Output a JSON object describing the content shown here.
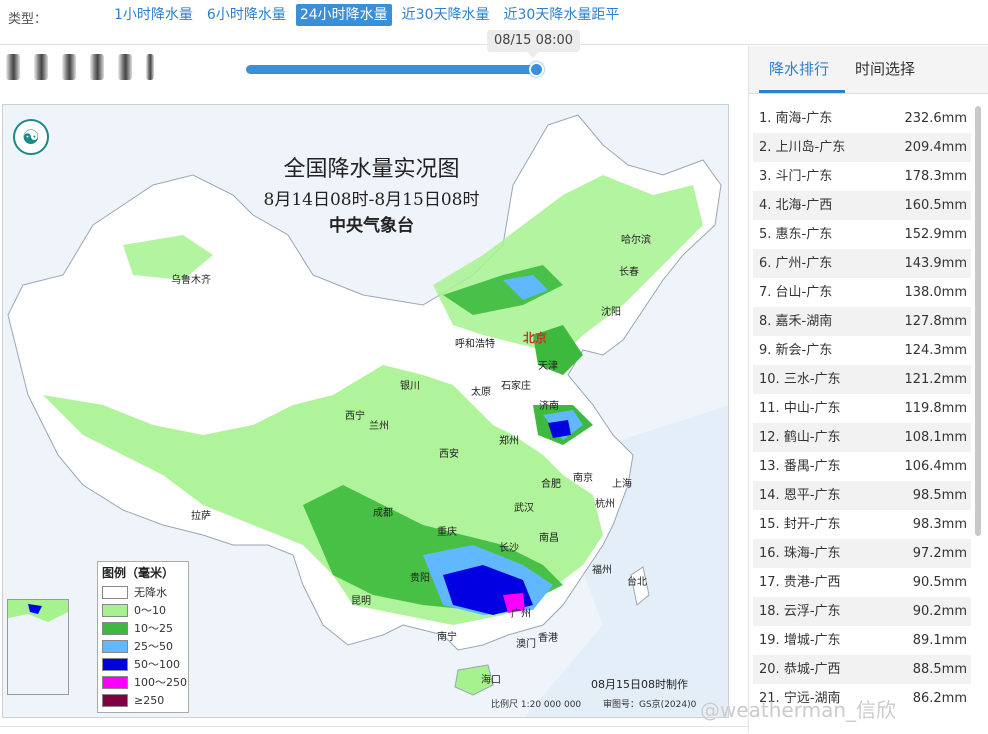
{
  "type_bar": {
    "label": "类型：",
    "tabs": [
      {
        "label": "1小时降水量",
        "active": false
      },
      {
        "label": "6小时降水量",
        "active": false
      },
      {
        "label": "24小时降水量",
        "active": true
      },
      {
        "label": "近30天降水量",
        "active": false
      },
      {
        "label": "近30天降水量距平",
        "active": false
      }
    ]
  },
  "timeline": {
    "current_time": "08/15 08:00",
    "progress_fraction": 1.0,
    "accent": "#3a8fd6"
  },
  "map": {
    "title": "全国降水量实况图",
    "period": "8月14日08时-8月15日08时",
    "agency": "中央气象台",
    "made_time": "08月15日08时制作",
    "scale": "比例尺 1:20 000 000",
    "review": "审图号：GS京(2024)0",
    "cities": [
      {
        "name": "北京",
        "capital": true
      },
      {
        "name": "哈尔滨"
      },
      {
        "name": "长春"
      },
      {
        "name": "沈阳"
      },
      {
        "name": "乌鲁木齐"
      },
      {
        "name": "呼和浩特"
      },
      {
        "name": "天津"
      },
      {
        "name": "石家庄"
      },
      {
        "name": "太原"
      },
      {
        "name": "银川"
      },
      {
        "name": "济南"
      },
      {
        "name": "西宁"
      },
      {
        "name": "兰州"
      },
      {
        "name": "郑州"
      },
      {
        "name": "西安"
      },
      {
        "name": "合肥"
      },
      {
        "name": "南京"
      },
      {
        "name": "上海"
      },
      {
        "name": "拉萨"
      },
      {
        "name": "成都"
      },
      {
        "name": "武汉"
      },
      {
        "name": "杭州"
      },
      {
        "name": "重庆"
      },
      {
        "name": "长沙"
      },
      {
        "name": "南昌"
      },
      {
        "name": "福州"
      },
      {
        "name": "贵阳"
      },
      {
        "name": "台北"
      },
      {
        "name": "昆明"
      },
      {
        "name": "广州"
      },
      {
        "name": "南宁"
      },
      {
        "name": "香港"
      },
      {
        "name": "澳门"
      },
      {
        "name": "海口"
      }
    ],
    "legend": {
      "title": "图例（毫米）",
      "items": [
        {
          "label": "无降水",
          "color": "#ffffff"
        },
        {
          "label": "0～10",
          "color": "#a6f28f"
        },
        {
          "label": "10～25",
          "color": "#3dba3d"
        },
        {
          "label": "25～50",
          "color": "#61b8ff"
        },
        {
          "label": "50～100",
          "color": "#0000e1"
        },
        {
          "label": "100～250",
          "color": "#fa00fa"
        },
        {
          "label": "≥250",
          "color": "#800040"
        }
      ]
    }
  },
  "right_panel": {
    "tabs": [
      {
        "label": "降水排行",
        "active": true
      },
      {
        "label": "时间选择",
        "active": false
      }
    ],
    "rankings": [
      {
        "rank": "1.",
        "station": "南海-广东",
        "value": "232.6mm"
      },
      {
        "rank": "2.",
        "station": "上川岛-广东",
        "value": "209.4mm"
      },
      {
        "rank": "3.",
        "station": "斗门-广东",
        "value": "178.3mm"
      },
      {
        "rank": "4.",
        "station": "北海-广西",
        "value": "160.5mm"
      },
      {
        "rank": "5.",
        "station": "惠东-广东",
        "value": "152.9mm"
      },
      {
        "rank": "6.",
        "station": "广州-广东",
        "value": "143.9mm"
      },
      {
        "rank": "7.",
        "station": "台山-广东",
        "value": "138.0mm"
      },
      {
        "rank": "8.",
        "station": "嘉禾-湖南",
        "value": "127.8mm"
      },
      {
        "rank": "9.",
        "station": "新会-广东",
        "value": "124.3mm"
      },
      {
        "rank": "10.",
        "station": "三水-广东",
        "value": "121.2mm"
      },
      {
        "rank": "11.",
        "station": "中山-广东",
        "value": "119.8mm"
      },
      {
        "rank": "12.",
        "station": "鹤山-广东",
        "value": "108.1mm"
      },
      {
        "rank": "13.",
        "station": "番禺-广东",
        "value": "106.4mm"
      },
      {
        "rank": "14.",
        "station": "恩平-广东",
        "value": "98.5mm"
      },
      {
        "rank": "15.",
        "station": "封开-广东",
        "value": "98.3mm"
      },
      {
        "rank": "16.",
        "station": "珠海-广东",
        "value": "97.2mm"
      },
      {
        "rank": "17.",
        "station": "贵港-广西",
        "value": "90.5mm"
      },
      {
        "rank": "18.",
        "station": "云浮-广东",
        "value": "90.2mm"
      },
      {
        "rank": "19.",
        "station": "增城-广东",
        "value": "89.1mm"
      },
      {
        "rank": "20.",
        "station": "恭城-广西",
        "value": "88.5mm"
      },
      {
        "rank": "21.",
        "station": "宁远-湖南",
        "value": "86.2mm"
      }
    ]
  },
  "watermark": "@weatherman_信欣"
}
